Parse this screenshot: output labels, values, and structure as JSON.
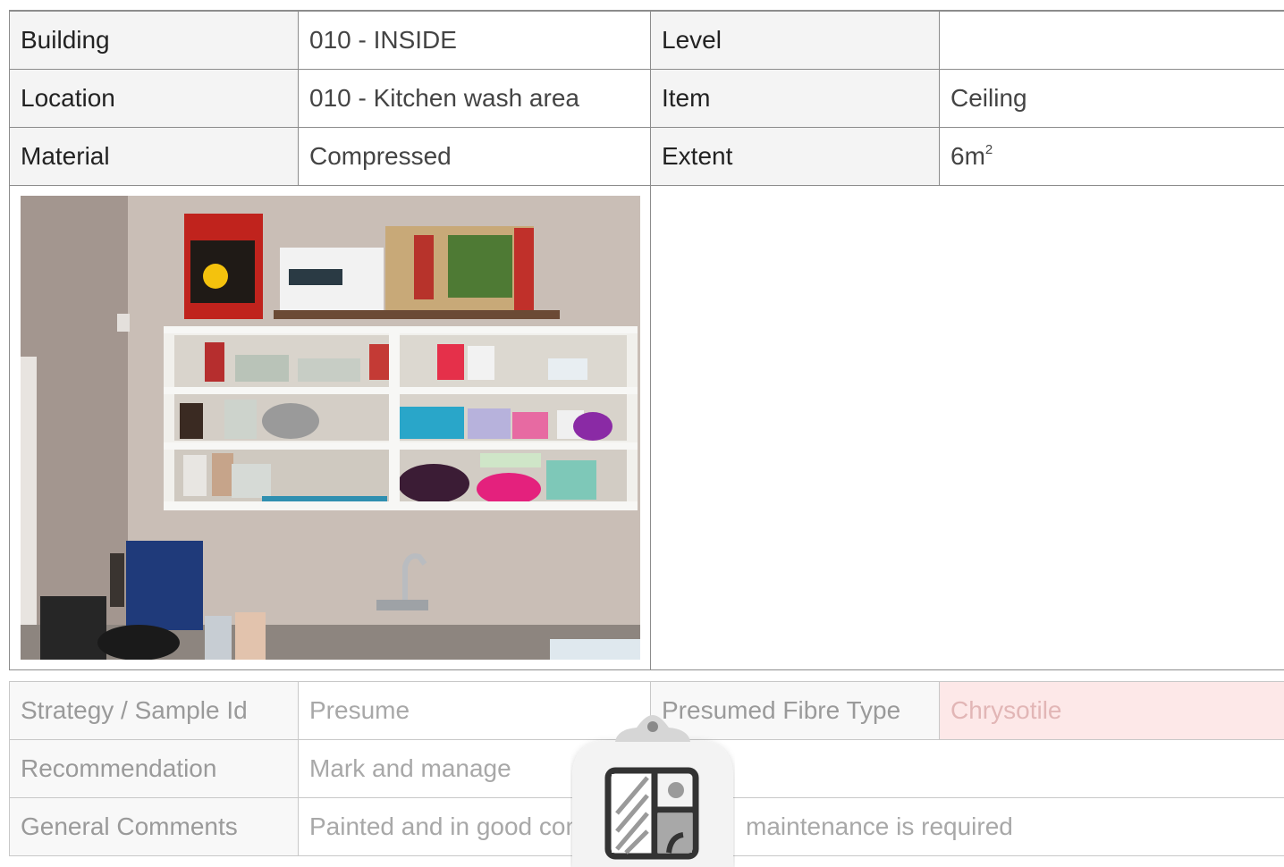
{
  "rows": {
    "building": {
      "label": "Building",
      "value": "010 - INSIDE"
    },
    "level": {
      "label": "Level",
      "value": ""
    },
    "location": {
      "label": "Location",
      "value": "010 - Kitchen wash area"
    },
    "item": {
      "label": "Item",
      "value": "Ceiling"
    },
    "material": {
      "label": "Material",
      "value": "Compressed"
    },
    "extent": {
      "label": "Extent",
      "value": "6m",
      "unit_sup": "2"
    }
  },
  "photo": {
    "subject": "kitchen wall shelf with boxes, jars, bowls and sink tap"
  },
  "lower": {
    "strategy": {
      "label": "Strategy / Sample Id",
      "value": "Presume"
    },
    "fibre": {
      "label": "Presumed Fibre Type",
      "value": "Chrysotile"
    },
    "recommendation": {
      "label": "Recommendation",
      "value": "Mark and manage"
    },
    "comments": {
      "label": "General Comments",
      "value_start": "Painted and in good con",
      "value_end": "maintenance is required"
    }
  },
  "colors": {
    "border": "#8c8c8c",
    "label_bg": "#f4f4f4",
    "fibre_bg": "#fde8e8"
  },
  "icons": {
    "overlay": "clipboard-layout-icon"
  }
}
